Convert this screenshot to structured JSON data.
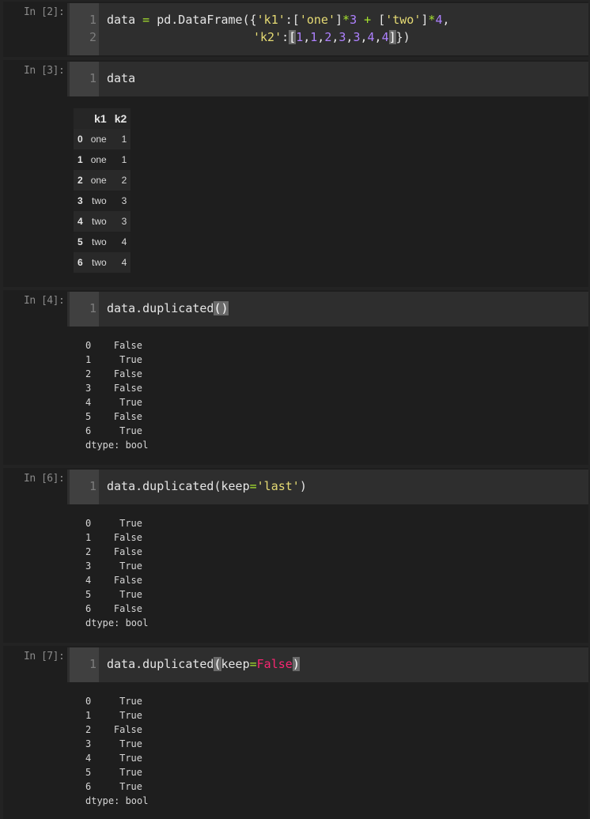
{
  "cells": [
    {
      "prompt": "In [2]:",
      "line_numbers": [
        "1",
        "2"
      ]
    },
    {
      "prompt": "In [3]:",
      "line_numbers": [
        "1"
      ],
      "code": "data",
      "table": {
        "columns": [
          "k1",
          "k2"
        ],
        "rows": [
          {
            "index": "0",
            "k1": "one",
            "k2": "1"
          },
          {
            "index": "1",
            "k1": "one",
            "k2": "1"
          },
          {
            "index": "2",
            "k1": "one",
            "k2": "2"
          },
          {
            "index": "3",
            "k1": "two",
            "k2": "3"
          },
          {
            "index": "4",
            "k1": "two",
            "k2": "3"
          },
          {
            "index": "5",
            "k1": "two",
            "k2": "4"
          },
          {
            "index": "6",
            "k1": "two",
            "k2": "4"
          }
        ]
      }
    },
    {
      "prompt": "In [4]:",
      "line_numbers": [
        "1"
      ],
      "output": [
        {
          "index": "0",
          "value": "False"
        },
        {
          "index": "1",
          "value": "True"
        },
        {
          "index": "2",
          "value": "False"
        },
        {
          "index": "3",
          "value": "False"
        },
        {
          "index": "4",
          "value": "True"
        },
        {
          "index": "5",
          "value": "False"
        },
        {
          "index": "6",
          "value": "True"
        }
      ],
      "dtype": "dtype: bool"
    },
    {
      "prompt": "In [6]:",
      "line_numbers": [
        "1"
      ],
      "output": [
        {
          "index": "0",
          "value": "True"
        },
        {
          "index": "1",
          "value": "False"
        },
        {
          "index": "2",
          "value": "False"
        },
        {
          "index": "3",
          "value": "True"
        },
        {
          "index": "4",
          "value": "False"
        },
        {
          "index": "5",
          "value": "True"
        },
        {
          "index": "6",
          "value": "False"
        }
      ],
      "dtype": "dtype: bool"
    },
    {
      "prompt": "In [7]:",
      "line_numbers": [
        "1"
      ],
      "output": [
        {
          "index": "0",
          "value": "True"
        },
        {
          "index": "1",
          "value": "True"
        },
        {
          "index": "2",
          "value": "False"
        },
        {
          "index": "3",
          "value": "True"
        },
        {
          "index": "4",
          "value": "True"
        },
        {
          "index": "5",
          "value": "True"
        },
        {
          "index": "6",
          "value": "True"
        }
      ],
      "dtype": "dtype: bool"
    }
  ],
  "code_tokens": {
    "c2_l1_var": "data",
    "c2_l1_eq": "=",
    "c2_l1_call": "pd.DataFrame({",
    "c2_l1_k1": "'k1'",
    "c2_l1_colon": ":[",
    "c2_l1_one": "'one'",
    "c2_l1_close1": "]",
    "c2_l1_mul1": "*",
    "c2_l1_three": "3",
    "c2_l1_plus": "+",
    "c2_l1_open2": "[",
    "c2_l1_two": "'two'",
    "c2_l1_close2": "]",
    "c2_l1_mul2": "*",
    "c2_l1_four": "4",
    "c2_l1_comma": ",",
    "c2_l2_k2": "'k2'",
    "c2_l2_colon": ":",
    "c2_l2_lbr": "[",
    "c2_l2_n1": "1",
    "c2_l2_c1": ",",
    "c2_l2_n2": "1",
    "c2_l2_c2": ",",
    "c2_l2_n3": "2",
    "c2_l2_c3": ",",
    "c2_l2_n4": "3",
    "c2_l2_c4": ",",
    "c2_l2_n5": "3",
    "c2_l2_c5": ",",
    "c2_l2_n6": "4",
    "c2_l2_c6": ",",
    "c2_l2_n7": "4",
    "c2_l2_rbr": "]",
    "c2_l2_end": "})",
    "c4_fn": "data.duplicated",
    "c4_paren": "()",
    "c6_fn": "data.duplicated(keep",
    "c6_eq": "=",
    "c6_str": "'last'",
    "c6_end": ")",
    "c7_fn": "data.duplicated",
    "c7_lp": "(",
    "c7_kw": "keep",
    "c7_eq": "=",
    "c7_false": "False",
    "c7_rp": ")"
  },
  "colors": {
    "background": "#232323",
    "cell_background": "#2e2e2e",
    "gutter": "#404040",
    "string": "#e6db74",
    "number": "#ae81ff",
    "operator": "#a6e22e",
    "keyword": "#f92672"
  }
}
